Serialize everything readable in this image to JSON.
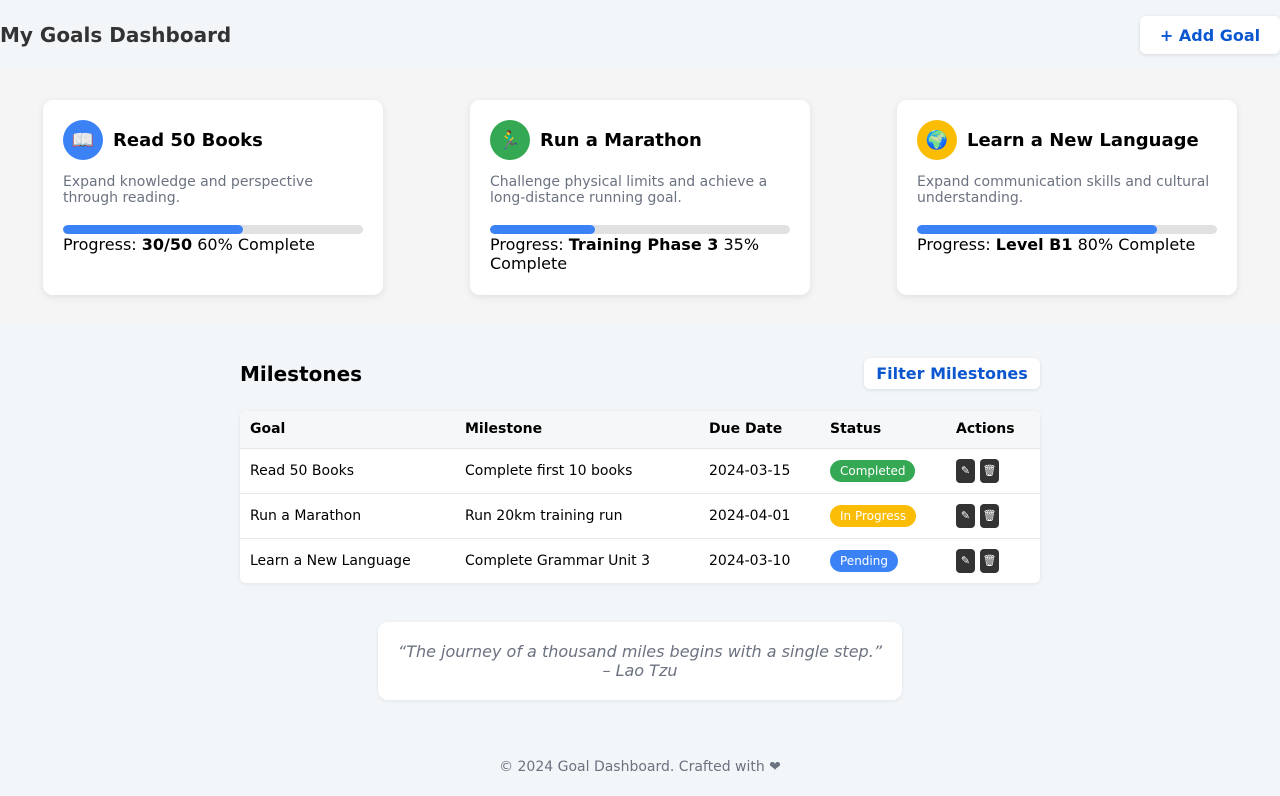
{
  "header": {
    "title": "My Goals Dashboard",
    "add_goal_label": "+ Add Goal"
  },
  "goals": [
    {
      "icon": "book-icon",
      "icon_glyph": "📖",
      "color": "#3b82f6",
      "title": "Read 50 Books",
      "description": "Expand knowledge and perspective through reading.",
      "progress_label": "Progress:",
      "progress_value": "30/50",
      "progress_complete": "60% Complete",
      "progress_fraction": 0.6
    },
    {
      "icon": "runner-icon",
      "icon_glyph": "🏃‍♂",
      "color": "#34a853",
      "title": "Run a Marathon",
      "description": "Challenge physical limits and achieve a long-distance running goal.",
      "progress_label": "Progress:",
      "progress_value": "Training Phase 3",
      "progress_complete": "35% Complete",
      "progress_fraction": 0.35
    },
    {
      "icon": "globe-icon",
      "icon_glyph": "🌍",
      "color": "#fbbc04",
      "title": "Learn a New Language",
      "description": "Expand communication skills and cultural understanding.",
      "progress_label": "Progress:",
      "progress_value": "Level B1",
      "progress_complete": "80% Complete",
      "progress_fraction": 0.8
    }
  ],
  "milestones": {
    "title": "Milestones",
    "filter_label": "Filter Milestones",
    "columns": [
      "Goal",
      "Milestone",
      "Due Date",
      "Status",
      "Actions"
    ],
    "rows": [
      {
        "goal": "Read 50 Books",
        "milestone": "Complete first 10 books",
        "due": "2024-03-15",
        "status": "Completed",
        "status_color": "#34a853"
      },
      {
        "goal": "Run a Marathon",
        "milestone": "Run 20km training run",
        "due": "2024-04-01",
        "status": "In Progress",
        "status_color": "#fbbc04"
      },
      {
        "goal": "Learn a New Language",
        "milestone": "Complete Grammar Unit 3",
        "due": "2024-03-10",
        "status": "Pending",
        "status_color": "#3b82f6"
      }
    ],
    "edit_icon": "✎",
    "delete_icon": "🗑"
  },
  "quote": {
    "text": "“The journey of a thousand miles begins with a single step.”",
    "author": "– Lao Tzu"
  },
  "footer": {
    "text": "© 2024 Goal Dashboard. Crafted with ❤"
  }
}
